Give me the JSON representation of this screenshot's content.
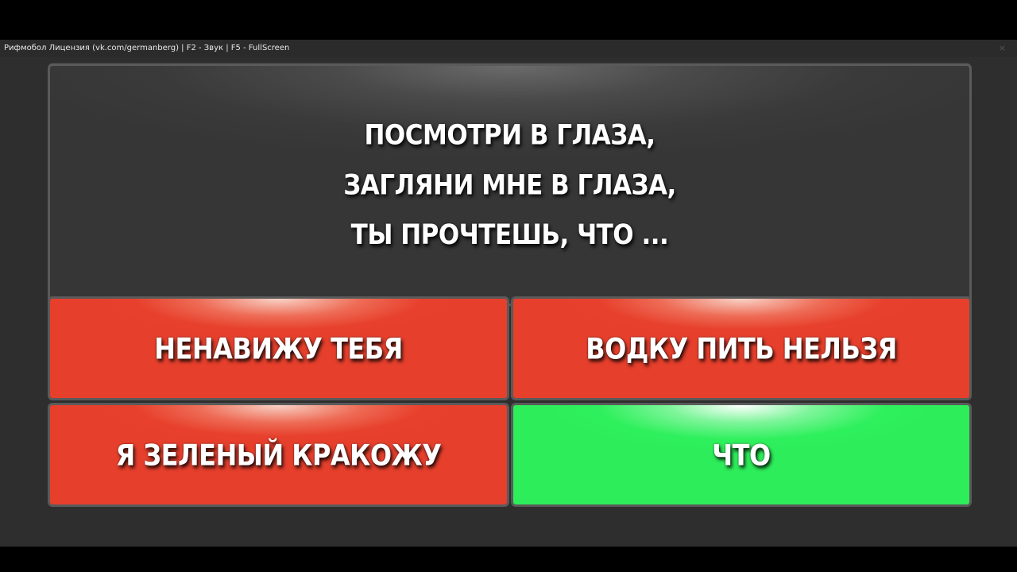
{
  "window": {
    "title": "Рифмобол Лицензия (vk.com/germanberg) | F2 - Звук | F5 - FullScreen",
    "close_glyph": "×"
  },
  "question": {
    "lines": [
      "ПОСМОТРИ В ГЛАЗА,",
      "ЗАГЛЯНИ МНЕ В ГЛАЗА,",
      "ТЫ ПРОЧТЕШЬ, ЧТО ..."
    ]
  },
  "answers": [
    {
      "label": "НЕНАВИЖУ ТЕБЯ",
      "color": "#e63f2c"
    },
    {
      "label": "ВОДКУ ПИТЬ НЕЛЬЗЯ",
      "color": "#e63f2c"
    },
    {
      "label": "Я ЗЕЛЕНЫЙ КРАКОЖУ",
      "color": "#e63f2c"
    },
    {
      "label": "ЧТО",
      "color": "#2ded5a"
    }
  ],
  "colors": {
    "background": "#2e2e2e",
    "panel_border": "#5a5a5a",
    "wrong_answer": "#e63f2c",
    "correct_answer": "#2ded5a"
  }
}
